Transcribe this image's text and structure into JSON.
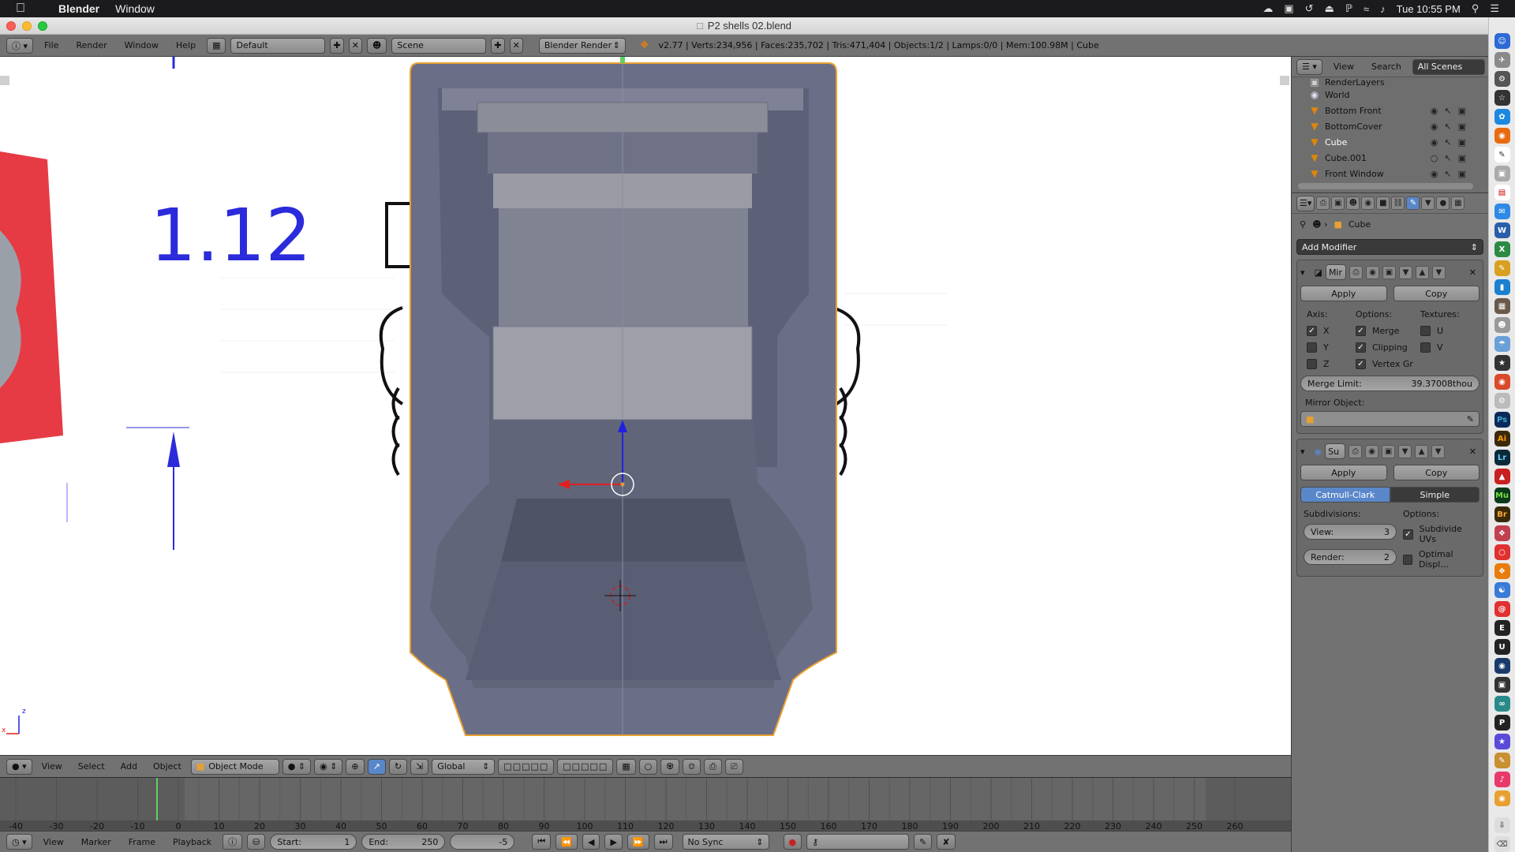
{
  "mac_menu": {
    "app": "Blender",
    "window": "Window",
    "clock": "Tue 10:55 PM"
  },
  "window_title": "P2 shells 02.blend",
  "info_header": {
    "menus": [
      "File",
      "Render",
      "Window",
      "Help"
    ],
    "layout": "Default",
    "scene": "Scene",
    "engine": "Blender Render",
    "stats": "v2.77 | Verts:234,956 | Faces:235,702 | Tris:471,404 | Objects:1/2 | Lamps:0/0 | Mem:100.98M | Cube"
  },
  "viewport": {
    "ref_number": "1.12"
  },
  "viewport_header": {
    "menus": [
      "View",
      "Select",
      "Add",
      "Object"
    ],
    "mode": "Object Mode",
    "orientation": "Global"
  },
  "timeline": {
    "ticks": [
      "-40",
      "-30",
      "-20",
      "-10",
      "0",
      "10",
      "20",
      "30",
      "40",
      "50",
      "60",
      "70",
      "80",
      "90",
      "100",
      "110",
      "120",
      "130",
      "140",
      "150",
      "160",
      "170",
      "180",
      "190",
      "200",
      "210",
      "220",
      "230",
      "240",
      "250",
      "260"
    ],
    "current_frame": 0
  },
  "timeline_header": {
    "menus": [
      "View",
      "Marker",
      "Frame",
      "Playback"
    ],
    "start_label": "Start:",
    "start_value": "1",
    "end_label": "End:",
    "end_value": "250",
    "current": "-5",
    "sync": "No Sync"
  },
  "outliner": {
    "view": "View",
    "search": "Search",
    "scope": "All Scenes",
    "items": [
      {
        "label": "RenderLayers"
      },
      {
        "label": "World"
      },
      {
        "label": "Bottom Front"
      },
      {
        "label": "BottomCover"
      },
      {
        "label": "Cube"
      },
      {
        "label": "Cube.001"
      },
      {
        "label": "Front Window"
      }
    ]
  },
  "properties": {
    "object": "Cube",
    "add_modifier": "Add Modifier",
    "mirror": {
      "name": "Mir",
      "apply": "Apply",
      "copy": "Copy",
      "axis": "Axis:",
      "options": "Options:",
      "textures": "Textures:",
      "x": "X",
      "y": "Y",
      "z": "Z",
      "merge": "Merge",
      "clipping": "Clipping",
      "vertex_gr": "Vertex Gr",
      "u": "U",
      "v": "V",
      "merge_limit_label": "Merge Limit:",
      "merge_limit_value": "39.37008thou",
      "mirror_object": "Mirror Object:"
    },
    "subsurf": {
      "name": "Su",
      "apply": "Apply",
      "copy": "Copy",
      "catmull": "Catmull-Clark",
      "simple": "Simple",
      "subdivisions": "Subdivisions:",
      "options": "Options:",
      "view_label": "View:",
      "view_value": "3",
      "render_label": "Render:",
      "render_value": "2",
      "subdivide_uvs": "Subdivide UVs",
      "optimal_displ": "Optimal Displ..."
    }
  },
  "colors": {
    "accent": "#5a87c9",
    "object_outline": "#e8a030"
  }
}
